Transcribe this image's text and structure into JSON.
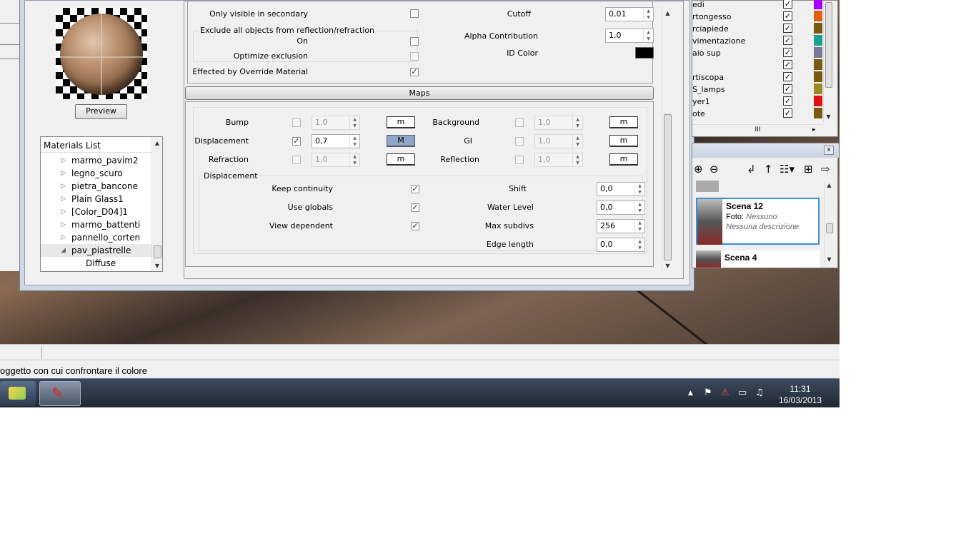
{
  "material_editor": {
    "preview_button": "Preview",
    "materials_list": {
      "header": "Materials List",
      "items": [
        {
          "label": "marmo_pavim2",
          "arrow": "▷"
        },
        {
          "label": "legno_scuro",
          "arrow": "▷"
        },
        {
          "label": "pietra_bancone",
          "arrow": "▷"
        },
        {
          "label": "Plain Glass1",
          "arrow": "▷"
        },
        {
          "label": "[Color_D04]1",
          "arrow": "▷"
        },
        {
          "label": "marmo_battenti",
          "arrow": "▷"
        },
        {
          "label": "pannello_corten",
          "arrow": "▷"
        },
        {
          "label": "pav_piastrelle",
          "arrow": "◢"
        }
      ],
      "child": "Diffuse"
    },
    "options": {
      "only_visible_secondary": "Only visible in secondary",
      "exclude_group_title": "Exclude all objects from reflection/refraction",
      "on_label": "On",
      "optimize_exclusion": "Optimize exclusion",
      "effected_by_override": "Effected by Override Material",
      "cutoff_label": "Cutoff",
      "cutoff_value": "0,01",
      "alpha_label": "Alpha Contribution",
      "alpha_value": "1,0",
      "id_color_label": "ID Color",
      "id_color": "#000000"
    },
    "maps": {
      "title": "Maps",
      "bump_label": "Bump",
      "bump_value": "1,0",
      "background_label": "Background",
      "background_value": "1,0",
      "displacement_label": "Displacement",
      "displacement_value": "0,7",
      "gi_label": "GI",
      "gi_value": "1,0",
      "refraction_label": "Refraction",
      "refraction_value": "1,0",
      "reflection_label": "Reflection",
      "reflection_value": "1,0",
      "m_lower": "m",
      "m_upper": "M"
    },
    "displacement": {
      "group_title": "Displacement",
      "keep_continuity": "Keep continuity",
      "use_globals": "Use globals",
      "view_dependent": "View dependent",
      "shift_label": "Shift",
      "shift_value": "0,0",
      "water_level_label": "Water Level",
      "water_level_value": "0,0",
      "max_subdivs_label": "Max subdivs",
      "max_subdivs_value": "256",
      "edge_length_label": "Edge length",
      "edge_length_value": "0,0"
    },
    "check_mark": "✓"
  },
  "layers": {
    "rows": [
      {
        "name": "edi",
        "color": "#a800ff"
      },
      {
        "name": "rtongesso",
        "color": "#e06010"
      },
      {
        "name": "rciapiede",
        "color": "#7a5a10"
      },
      {
        "name": "vimentazione",
        "color": "#1aa090"
      },
      {
        "name": "aio sup",
        "color": "#7a7a98"
      },
      {
        "name": "",
        "color": "#7a5a10"
      },
      {
        "name": "rtiscopa",
        "color": "#7a5a10"
      },
      {
        "name": "S_lamps",
        "color": "#9a8a20"
      },
      {
        "name": "yer1",
        "color": "#e01010"
      },
      {
        "name": "ote",
        "color": "#7a5a10"
      }
    ],
    "scroll_mid": "III"
  },
  "scenes": {
    "cards": [
      {
        "name": "Scena 12",
        "foto_label": "Foto:",
        "foto_value": "Nessuno",
        "description": "Nessuna descrizione"
      },
      {
        "name": "Scena 4"
      }
    ],
    "close": "x"
  },
  "status_bar": {
    "hint": "oggetto con cui confrontare il colore"
  },
  "taskbar": {
    "time": "11:31",
    "date": "16/03/2013"
  }
}
